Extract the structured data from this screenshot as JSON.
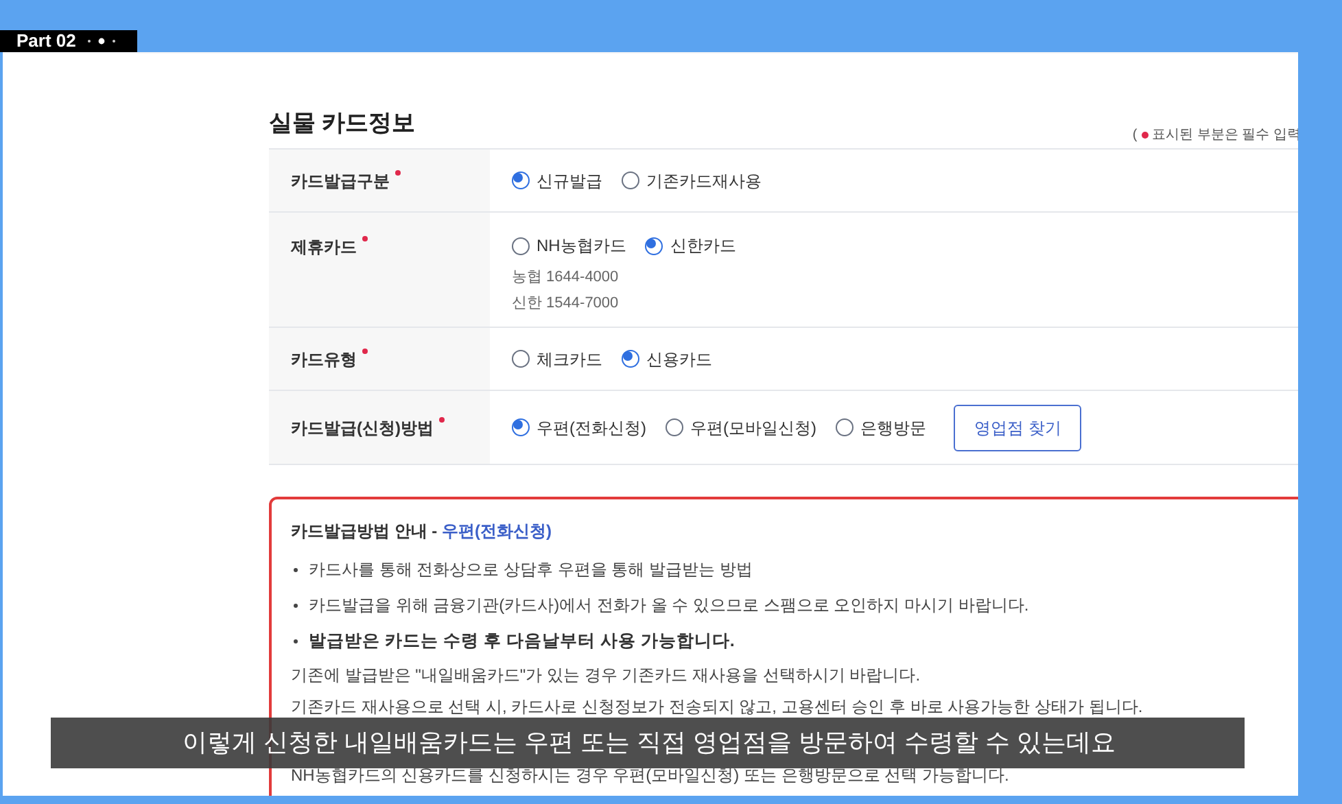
{
  "episode_tab": {
    "label": "Part 02"
  },
  "section_title": "실물 카드정보",
  "required_note": {
    "prefix": "(",
    "text": "표시된 부분은 필수 입력"
  },
  "form_rows": [
    {
      "label": "카드발급구분",
      "required": true,
      "options": [
        {
          "label": "신규발급",
          "selected": true
        },
        {
          "label": "기존카드재사용",
          "selected": false
        }
      ]
    },
    {
      "label": "제휴카드",
      "required": true,
      "options": [
        {
          "label": "NH농협카드",
          "selected": false
        },
        {
          "label": "신한카드",
          "selected": true
        }
      ],
      "notes": [
        "농협 1644-4000",
        "신한 1544-7000"
      ]
    },
    {
      "label": "카드유형",
      "required": true,
      "options": [
        {
          "label": "체크카드",
          "selected": false
        },
        {
          "label": "신용카드",
          "selected": true
        }
      ]
    },
    {
      "label": "카드발급(신청)방법",
      "required": true,
      "options": [
        {
          "label": "우편(전화신청)",
          "selected": true
        },
        {
          "label": "우편(모바일신청)",
          "selected": false
        },
        {
          "label": "은행방문",
          "selected": false
        }
      ],
      "button": "영업점 찾기"
    }
  ],
  "guide": {
    "title": "카드발급방법 안내 - ",
    "method": "우편(전화신청)",
    "lines": [
      {
        "kind": "bullet",
        "text": "카드사를 통해 전화상으로 상담후 우편을 통해 발급받는 방법"
      },
      {
        "kind": "bullet",
        "text": "카드발급을 위해 금융기관(카드사)에서 전화가 올 수 있으므로 스팸으로 오인하지 마시기 바랍니다."
      },
      {
        "kind": "bold_bullet",
        "text": "발급받은 카드는 수령 후 다음날부터 사용 가능합니다."
      },
      {
        "kind": "plain",
        "text": "기존에 발급받은 \"내일배움카드\"가 있는 경우 기존카드 재사용을 선택하시기 바랍니다."
      },
      {
        "kind": "plain",
        "text": "기존카드 재사용으로 선택 시, 카드사로 신청정보가 전송되지 않고, 고용센터 승인 후 바로 사용가능한 상태가 됩니다."
      },
      {
        "kind": "after_gap",
        "text": "NH농협카드의 신용카드를 신청하시는 경우 우편(모바일신청) 또는 은행방문으로 선택 가능합니다."
      }
    ]
  },
  "subtitle": "이렇게 신청한 내일배움카드는 우편 또는 직접 영업점을 방문하여 수령할 수 있는데요"
}
